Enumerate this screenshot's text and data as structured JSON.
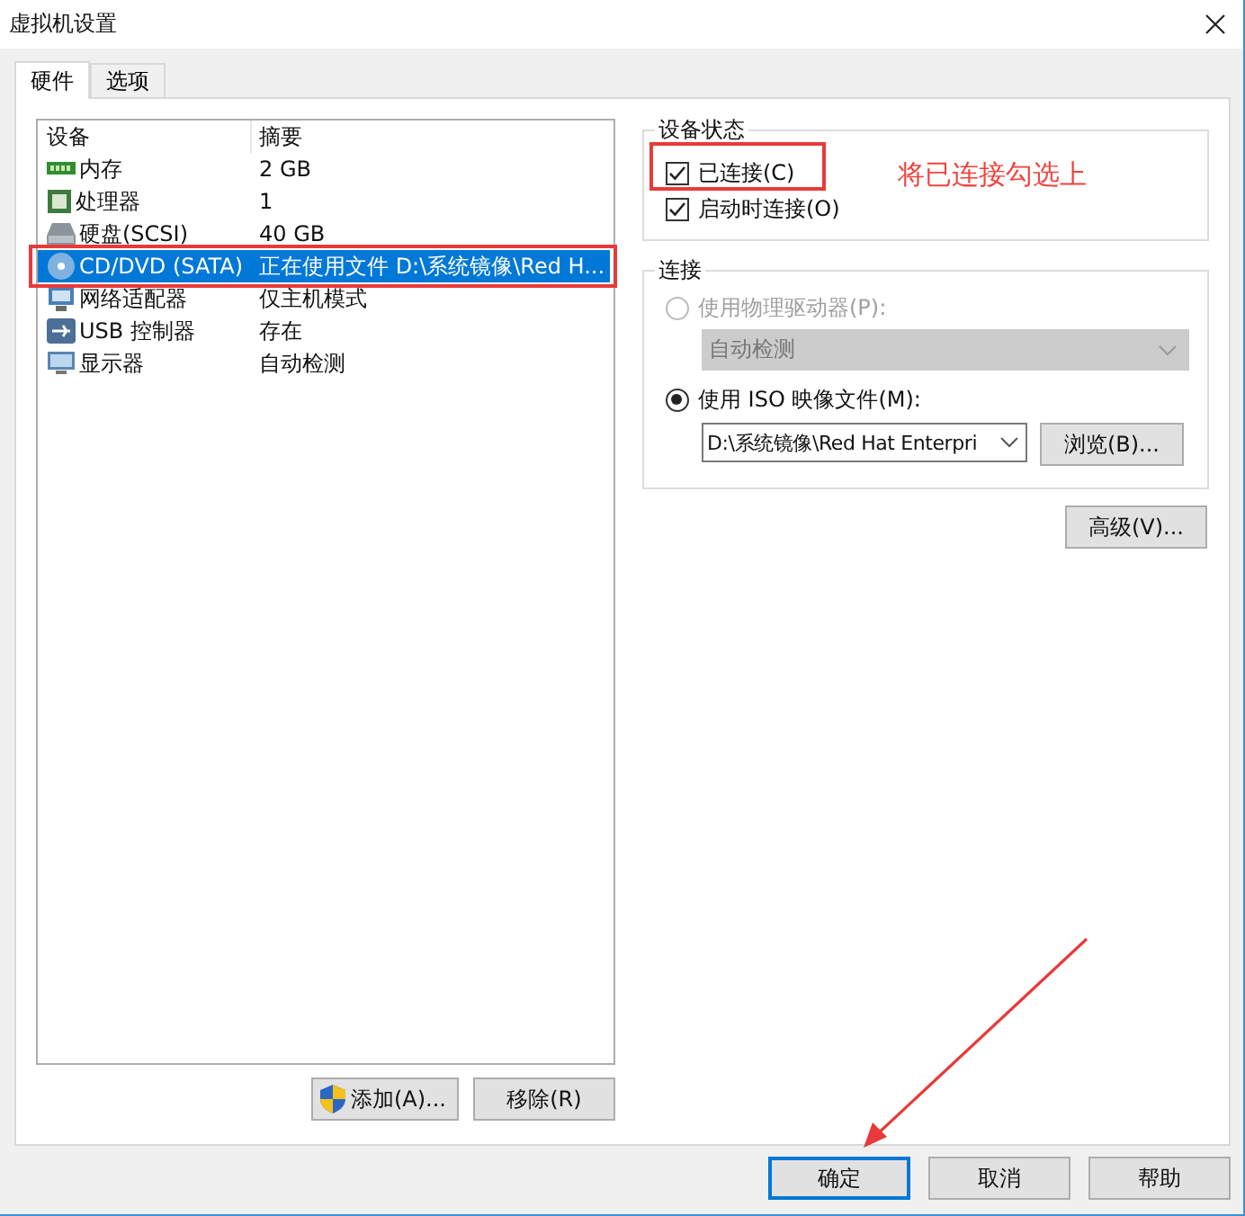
{
  "window": {
    "title": "虚拟机设置"
  },
  "tabs": [
    {
      "label": "硬件",
      "selected": true
    },
    {
      "label": "选项",
      "selected": false
    }
  ],
  "device_list": {
    "columns": [
      "设备",
      "摘要"
    ],
    "rows": [
      {
        "device": "内存",
        "summary": "2 GB",
        "selected": false
      },
      {
        "device": "处理器",
        "summary": "1",
        "selected": false
      },
      {
        "device": "硬盘(SCSI)",
        "summary": "40 GB",
        "selected": false
      },
      {
        "device": "CD/DVD (SATA)",
        "summary": "正在使用文件 D:\\系统镜像\\Red H...",
        "selected": true
      },
      {
        "device": "网络适配器",
        "summary": "仅主机模式",
        "selected": false
      },
      {
        "device": "USB 控制器",
        "summary": "存在",
        "selected": false
      },
      {
        "device": "显示器",
        "summary": "自动检测",
        "selected": false
      }
    ]
  },
  "add_button": "添加(A)...",
  "remove_button": "移除(R)",
  "device_status": {
    "title": "设备状态",
    "options": [
      {
        "label": "已连接(C)",
        "checked": true
      },
      {
        "label": "启动时连接(O)",
        "checked": true
      }
    ]
  },
  "connection": {
    "title": "连接",
    "physical_drive": {
      "label": "使用物理驱动器(P):",
      "selected": false,
      "disabled": true
    },
    "drive_select": {
      "value": "自动检测",
      "disabled": true
    },
    "iso_file": {
      "label": "使用 ISO 映像文件(M):",
      "selected": true,
      "disabled": false
    },
    "iso_select": {
      "value": "D:\\系统镜像\\Red Hat Enterpri"
    },
    "browse_button": "浏览(B)..."
  },
  "advanced_button": "高级(V)...",
  "dialog_buttons": [
    {
      "label": "确定",
      "default": true
    },
    {
      "label": "取消",
      "default": false
    },
    {
      "label": "帮助",
      "default": false
    }
  ],
  "annotation": {
    "note": "将已连接勾选上"
  }
}
